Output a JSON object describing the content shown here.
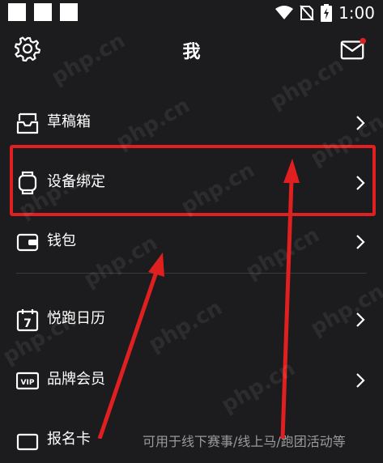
{
  "status_bar": {
    "time": "1:00"
  },
  "header": {
    "title": "我"
  },
  "menu": {
    "items": [
      {
        "label": "草稿箱",
        "icon": "drafts-icon"
      },
      {
        "label": "设备绑定",
        "icon": "watch-icon"
      },
      {
        "label": "钱包",
        "icon": "wallet-icon"
      },
      {
        "label": "悦跑日历",
        "icon": "calendar-icon",
        "icon_text": "7"
      },
      {
        "label": "品牌会员",
        "icon": "vip-icon",
        "icon_text": "VIP"
      },
      {
        "label": "报名卡",
        "icon": "ticket-icon",
        "subtitle": "可用于线下赛事/线上马/跑团活动等"
      }
    ]
  },
  "annotation": {
    "highlight_color": "#e02020",
    "arrow_color": "#e02020"
  },
  "watermark": {
    "text": "php.cn"
  }
}
